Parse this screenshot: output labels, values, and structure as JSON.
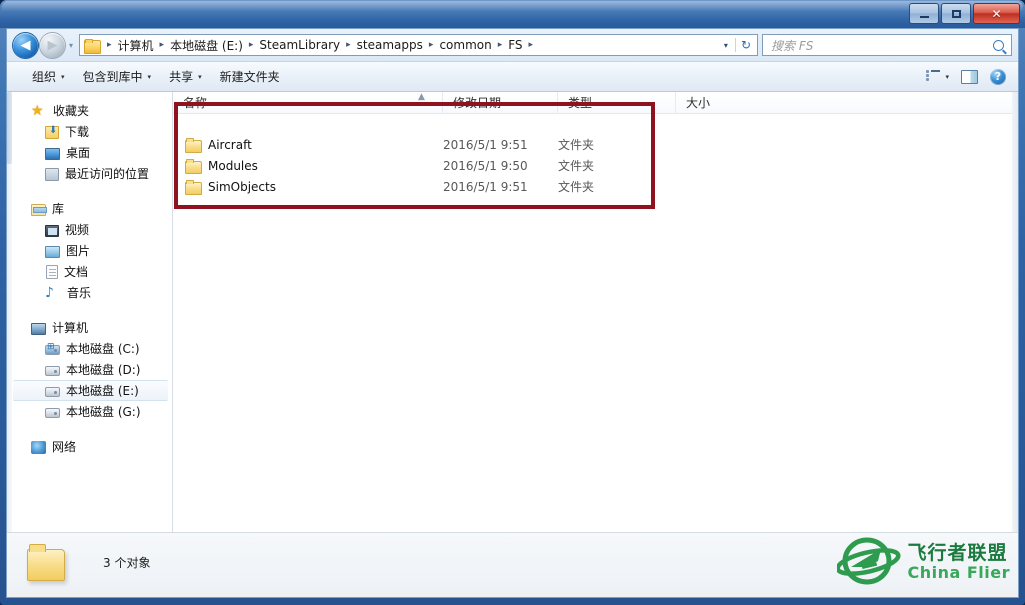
{
  "window": {
    "title": "",
    "buttons": {
      "minimize": "—",
      "maximize": "❐",
      "close": "✕"
    }
  },
  "address": {
    "back_glyph": "◀",
    "forward_glyph": "▶",
    "history_caret": "▾",
    "breadcrumbs": [
      "计算机",
      "本地磁盘 (E:)",
      "SteamLibrary",
      "steamapps",
      "common",
      "FS"
    ],
    "separator": "▸",
    "dropdown_caret": "▾",
    "refresh_glyph": "↻"
  },
  "search": {
    "placeholder": "搜索 FS"
  },
  "toolbar": {
    "items": [
      {
        "label": "组织",
        "has_caret": true
      },
      {
        "label": "包含到库中",
        "has_caret": true
      },
      {
        "label": "共享",
        "has_caret": true
      },
      {
        "label": "新建文件夹",
        "has_caret": false
      }
    ],
    "view_caret": "▾"
  },
  "sidebar": {
    "groups": [
      {
        "header": {
          "label": "收藏夹",
          "icon": "star-icon"
        },
        "items": [
          {
            "label": "下载",
            "icon": "downloads-icon"
          },
          {
            "label": "桌面",
            "icon": "desktop-icon"
          },
          {
            "label": "最近访问的位置",
            "icon": "recent-places-icon"
          }
        ]
      },
      {
        "header": {
          "label": "库",
          "icon": "library-icon"
        },
        "items": [
          {
            "label": "视频",
            "icon": "video-icon"
          },
          {
            "label": "图片",
            "icon": "pictures-icon"
          },
          {
            "label": "文档",
            "icon": "documents-icon"
          },
          {
            "label": "音乐",
            "icon": "music-icon"
          }
        ]
      },
      {
        "header": {
          "label": "计算机",
          "icon": "computer-icon"
        },
        "items": [
          {
            "label": "本地磁盘 (C:)",
            "icon": "system-drive-icon",
            "selected": false
          },
          {
            "label": "本地磁盘 (D:)",
            "icon": "drive-icon",
            "selected": false
          },
          {
            "label": "本地磁盘 (E:)",
            "icon": "drive-icon",
            "selected": true
          },
          {
            "label": "本地磁盘 (G:)",
            "icon": "drive-icon",
            "selected": false
          }
        ]
      },
      {
        "header": {
          "label": "网络",
          "icon": "network-icon"
        },
        "items": []
      }
    ]
  },
  "filelist": {
    "columns": [
      "名称",
      "修改日期",
      "类型",
      "大小"
    ],
    "sort_arrow": "▲",
    "rows": [
      {
        "name": "Aircraft",
        "modified": "2016/5/1 9:51",
        "type": "文件夹",
        "size": ""
      },
      {
        "name": "Modules",
        "modified": "2016/5/1 9:50",
        "type": "文件夹",
        "size": ""
      },
      {
        "name": "SimObjects",
        "modified": "2016/5/1 9:51",
        "type": "文件夹",
        "size": ""
      }
    ],
    "highlight_color": "#8e131f"
  },
  "status": {
    "text": "3 个对象"
  },
  "watermark": {
    "chinese": "飞行者联盟",
    "english": "China Flier",
    "color": "#2e9b4e"
  }
}
